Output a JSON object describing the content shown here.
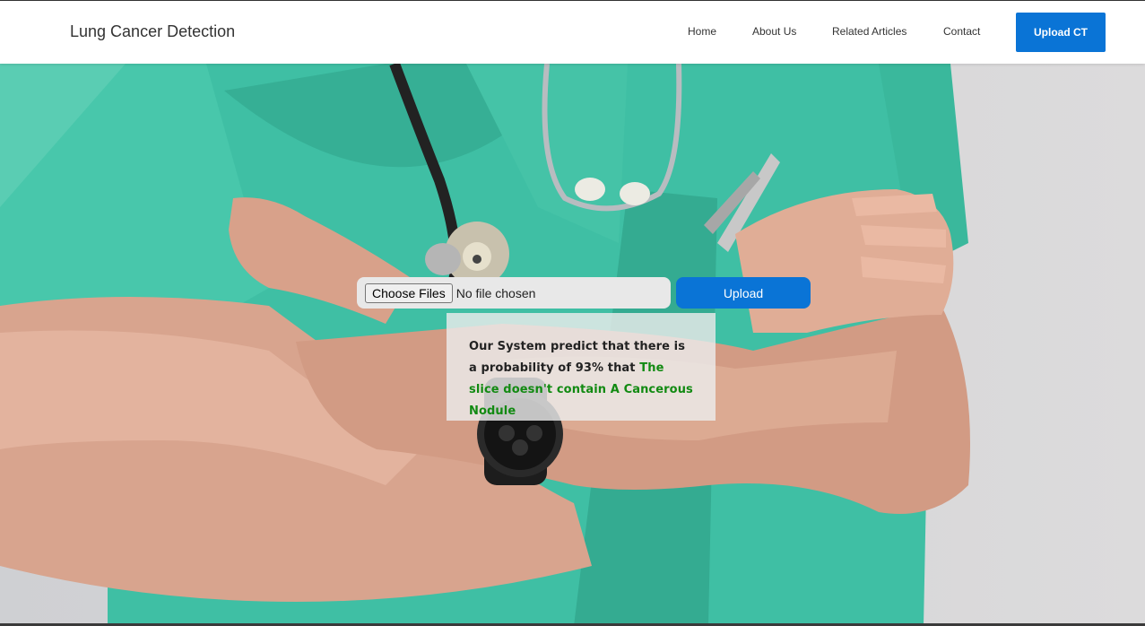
{
  "navbar": {
    "brand": "Lung Cancer Detection",
    "links": [
      "Home",
      "About Us",
      "Related Articles",
      "Contact"
    ],
    "cta_label": "Upload CT",
    "cta_color": "#0a74d6"
  },
  "upload_form": {
    "choose_label": "Choose Files",
    "file_status": "No file chosen",
    "submit_label": "Upload"
  },
  "result": {
    "prefix": "Our System predict that there is a probability of 93% that ",
    "verdict": "The slice doesn't contain A Cancerous Nodule",
    "probability_percent": 93,
    "verdict_color": "#128a12"
  },
  "hero": {
    "image_subject": "doctor-in-scrubs-with-stethoscope-arms-crossed"
  }
}
